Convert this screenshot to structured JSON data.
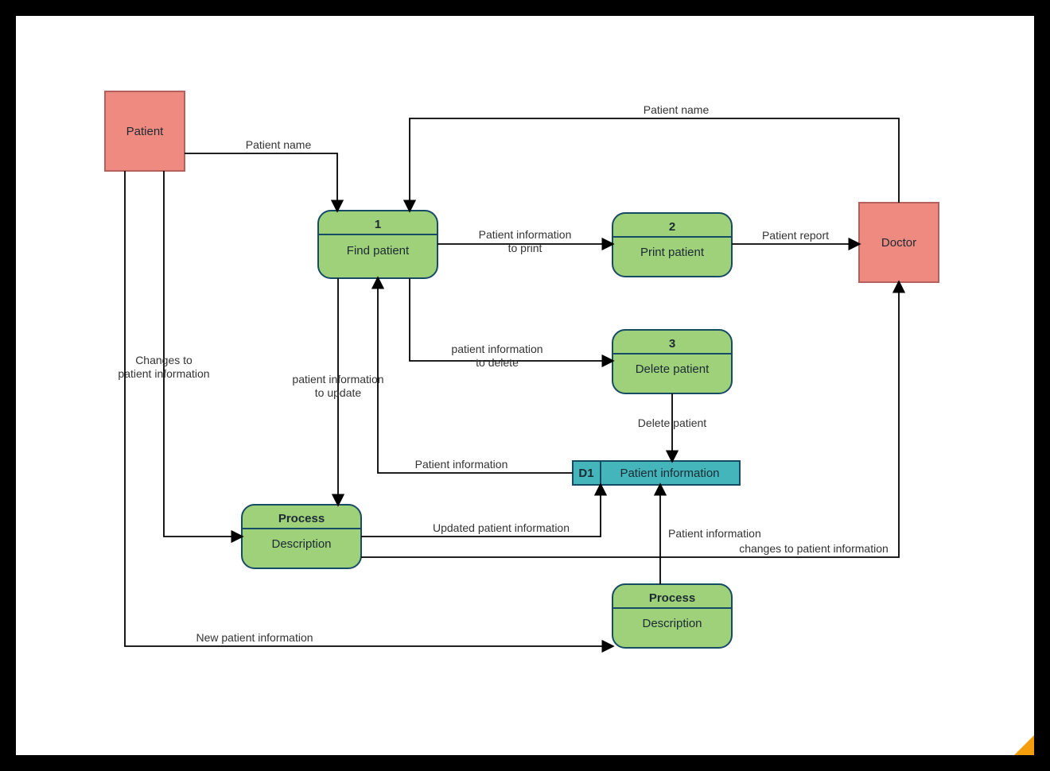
{
  "entities": {
    "patient": {
      "label": "Patient"
    },
    "doctor": {
      "label": "Doctor"
    }
  },
  "processes": {
    "find": {
      "num": "1",
      "label": "Find patient"
    },
    "print": {
      "num": "2",
      "label": "Print patient"
    },
    "delete": {
      "num": "3",
      "label": "Delete patient"
    },
    "update": {
      "num": "Process",
      "label": "Description"
    },
    "add": {
      "num": "Process",
      "label": "Description"
    }
  },
  "datastore": {
    "id": "D1",
    "label": "Patient information"
  },
  "flows": {
    "patient_to_find": "Patient name",
    "doctor_to_find": "Patient name",
    "find_to_print": "Patient information\nto print",
    "print_to_doctor": "Patient report",
    "find_to_delete": "patient information\nto delete",
    "delete_to_ds": "Delete patient",
    "ds_to_find": "Patient information",
    "find_to_update": "patient information\nto update",
    "patient_to_update": "Changes to\npatient information",
    "update_to_ds": "Updated patient information",
    "update_to_doctor": "changes to patient information",
    "add_to_ds": "Patient information",
    "patient_to_add": "New patient information"
  }
}
